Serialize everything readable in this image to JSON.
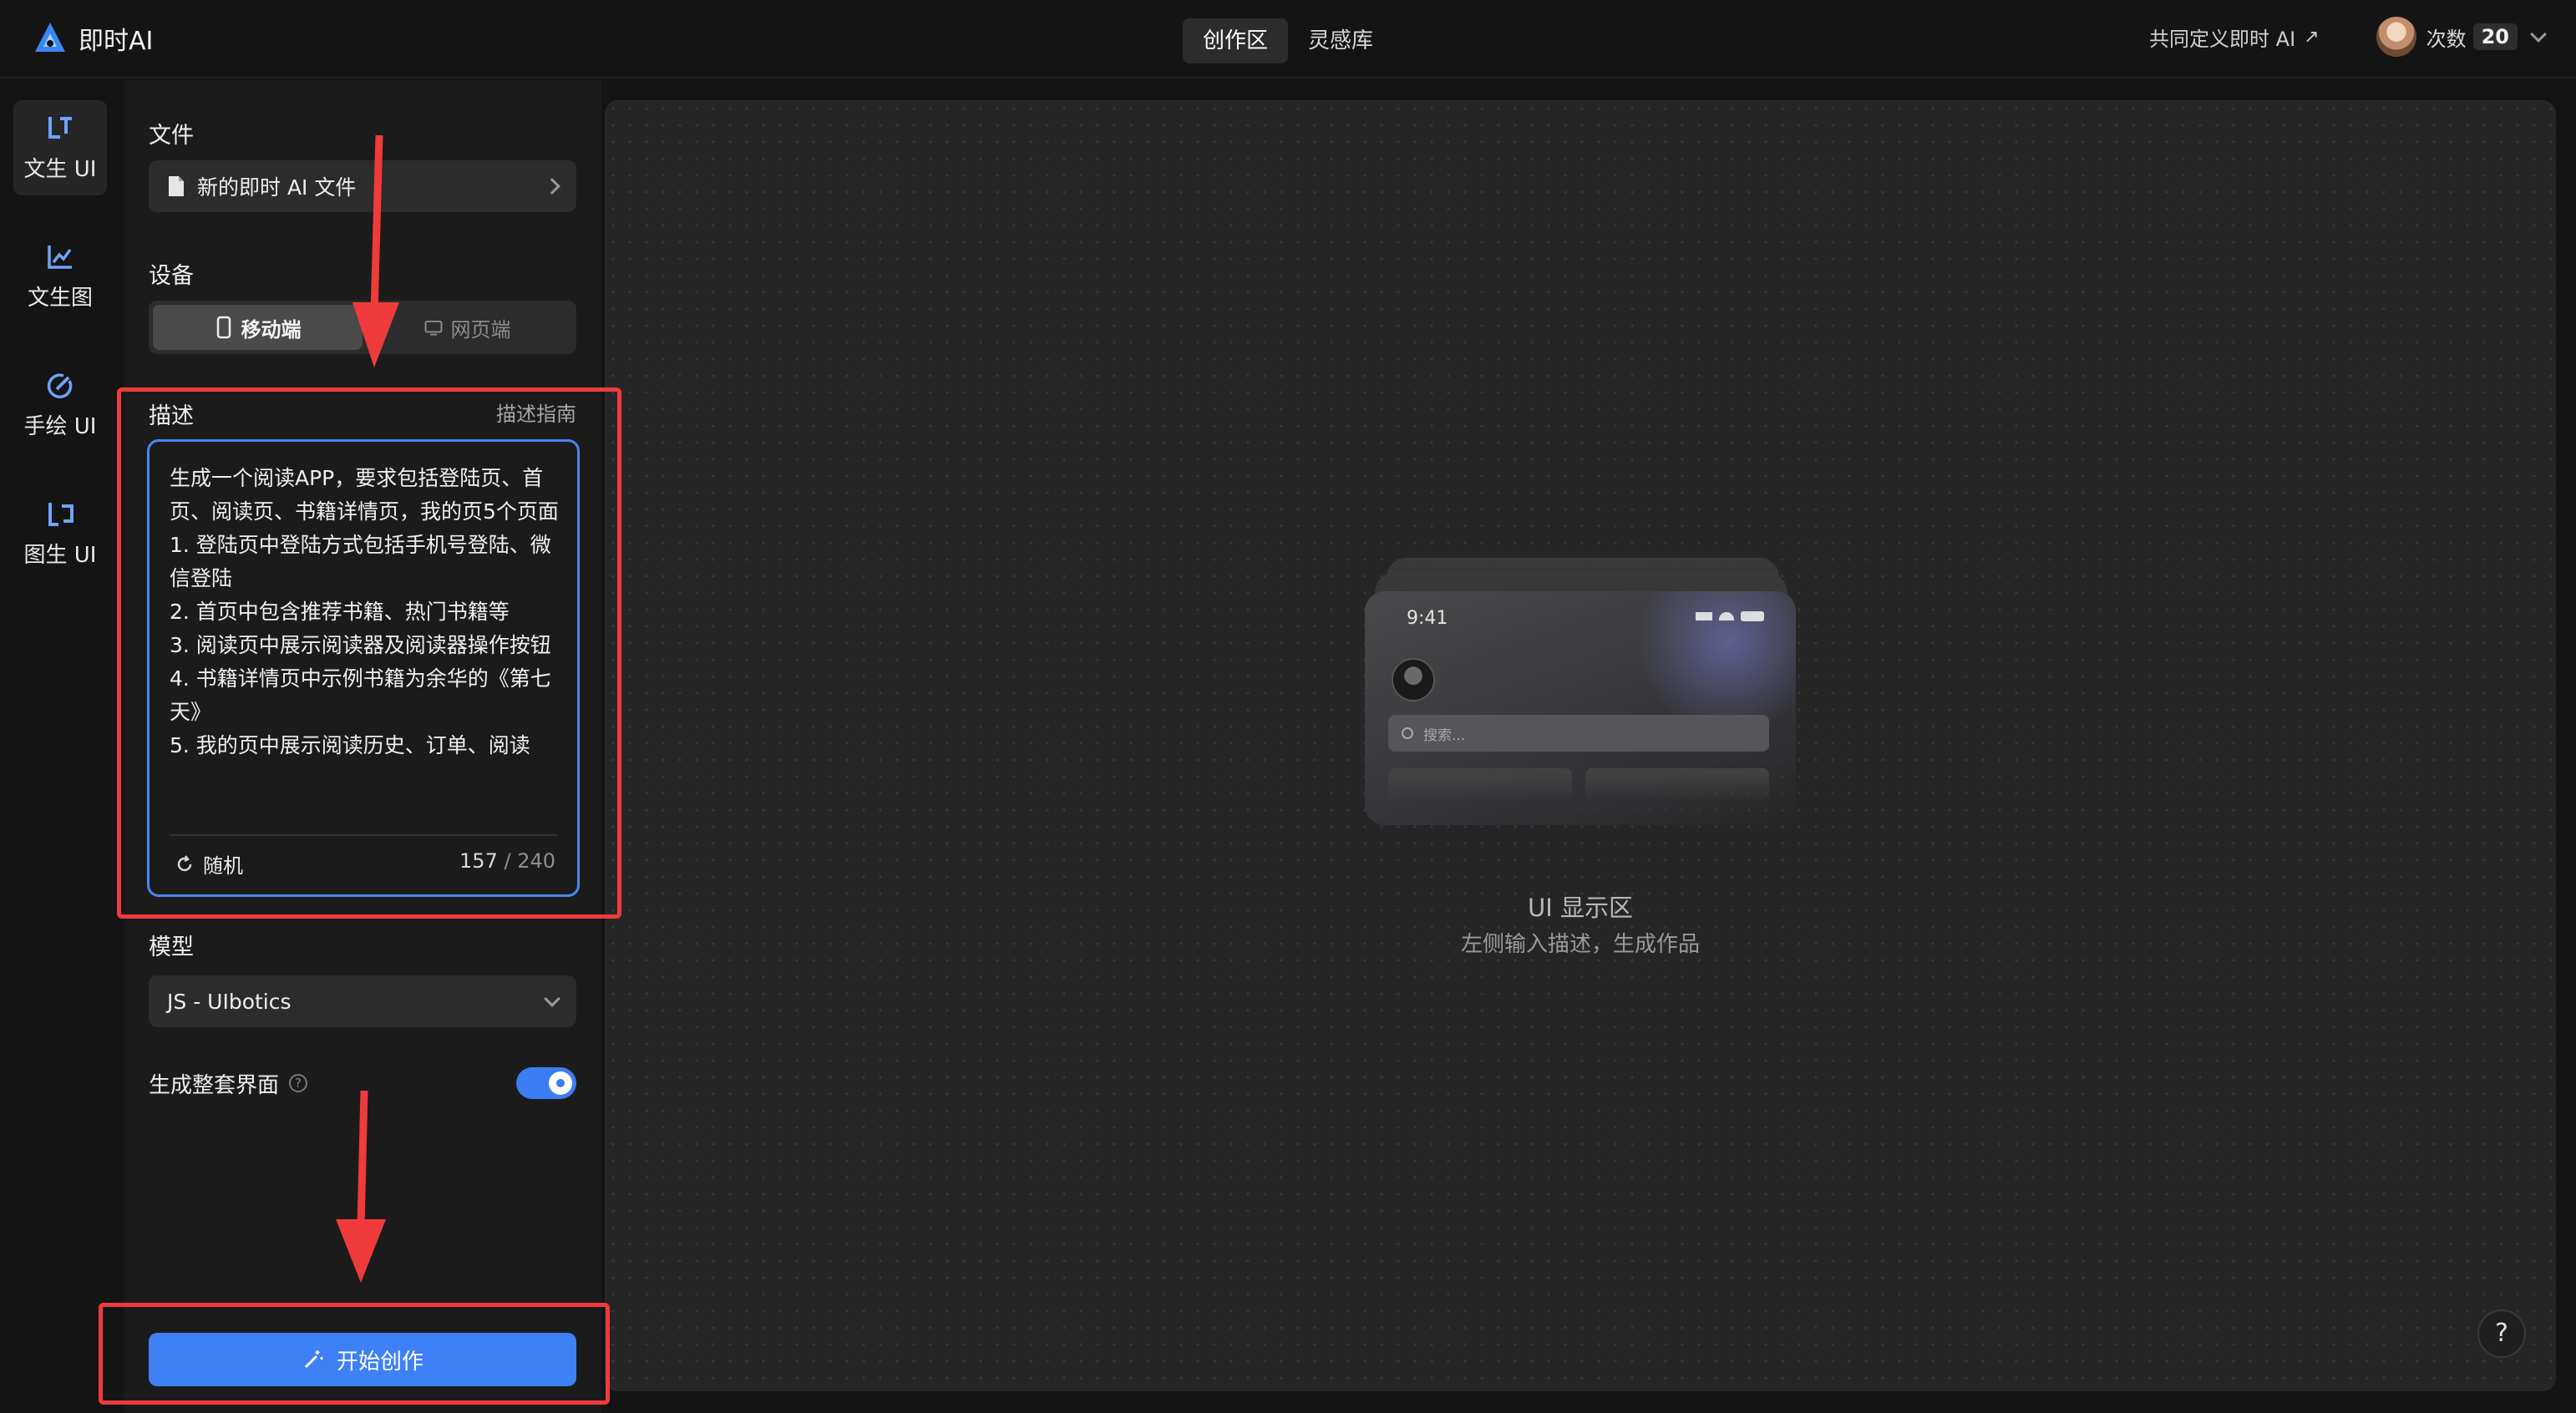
{
  "app": {
    "name": "即时AI"
  },
  "top_nav": {
    "tabs": [
      "创作区",
      "灵感库"
    ]
  },
  "header_right": {
    "define_link": "共同定义即时 AI",
    "define_arrow": "↗",
    "count_label": "次数",
    "count_value": "20"
  },
  "rail": {
    "items": [
      "文生 UI",
      "文生图",
      "手绘 UI",
      "图生 UI"
    ]
  },
  "panel": {
    "file": {
      "title": "文件",
      "name": "新的即时 AI 文件"
    },
    "device": {
      "title": "设备",
      "options": [
        "移动端",
        "网页端"
      ]
    },
    "description": {
      "title": "描述",
      "guide": "描述指南",
      "text": "生成一个阅读APP，要求包括登陆页、首页、阅读页、书籍详情页，我的页5个页面\n1. 登陆页中登陆方式包括手机号登陆、微信登陆\n2. 首页中包含推荐书籍、热门书籍等\n3. 阅读页中展示阅读器及阅读器操作按钮\n4. 书籍详情页中示例书籍为余华的《第七天》\n5. 我的页中展示阅读历史、订单、阅读",
      "random": "随机",
      "count": "157",
      "max": " / 240"
    },
    "model": {
      "title": "模型",
      "value": "JS - UIbotics"
    },
    "full_set": {
      "label": "生成整套界面",
      "help": "?",
      "enabled": true
    },
    "start_button": "开始创作"
  },
  "canvas": {
    "title": "UI 显示区",
    "subtitle": "左侧输入描述，生成作品",
    "preview": {
      "time": "9:41",
      "search_placeholder": "搜索..."
    },
    "help": "?"
  },
  "colors": {
    "accent": "#3e80f5",
    "annotation": "#ef3b3b",
    "background": "#141414"
  }
}
